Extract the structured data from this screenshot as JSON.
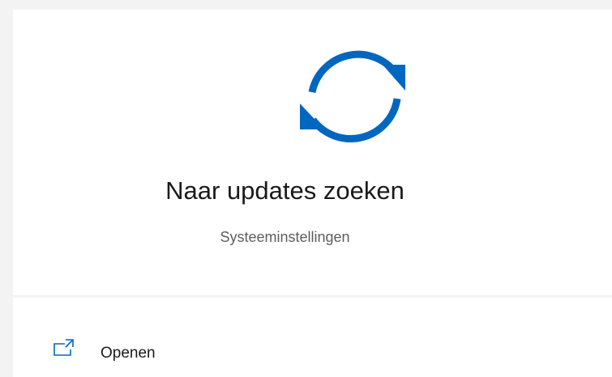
{
  "result": {
    "title": "Naar updates zoeken",
    "subtitle": "Systeeminstellingen",
    "icon": "sync-icon"
  },
  "actions": [
    {
      "label": "Openen",
      "icon": "open-external-icon"
    }
  ],
  "colors": {
    "accent": "#0067c0",
    "background": "#f3f3f3",
    "panel": "#ffffff"
  }
}
